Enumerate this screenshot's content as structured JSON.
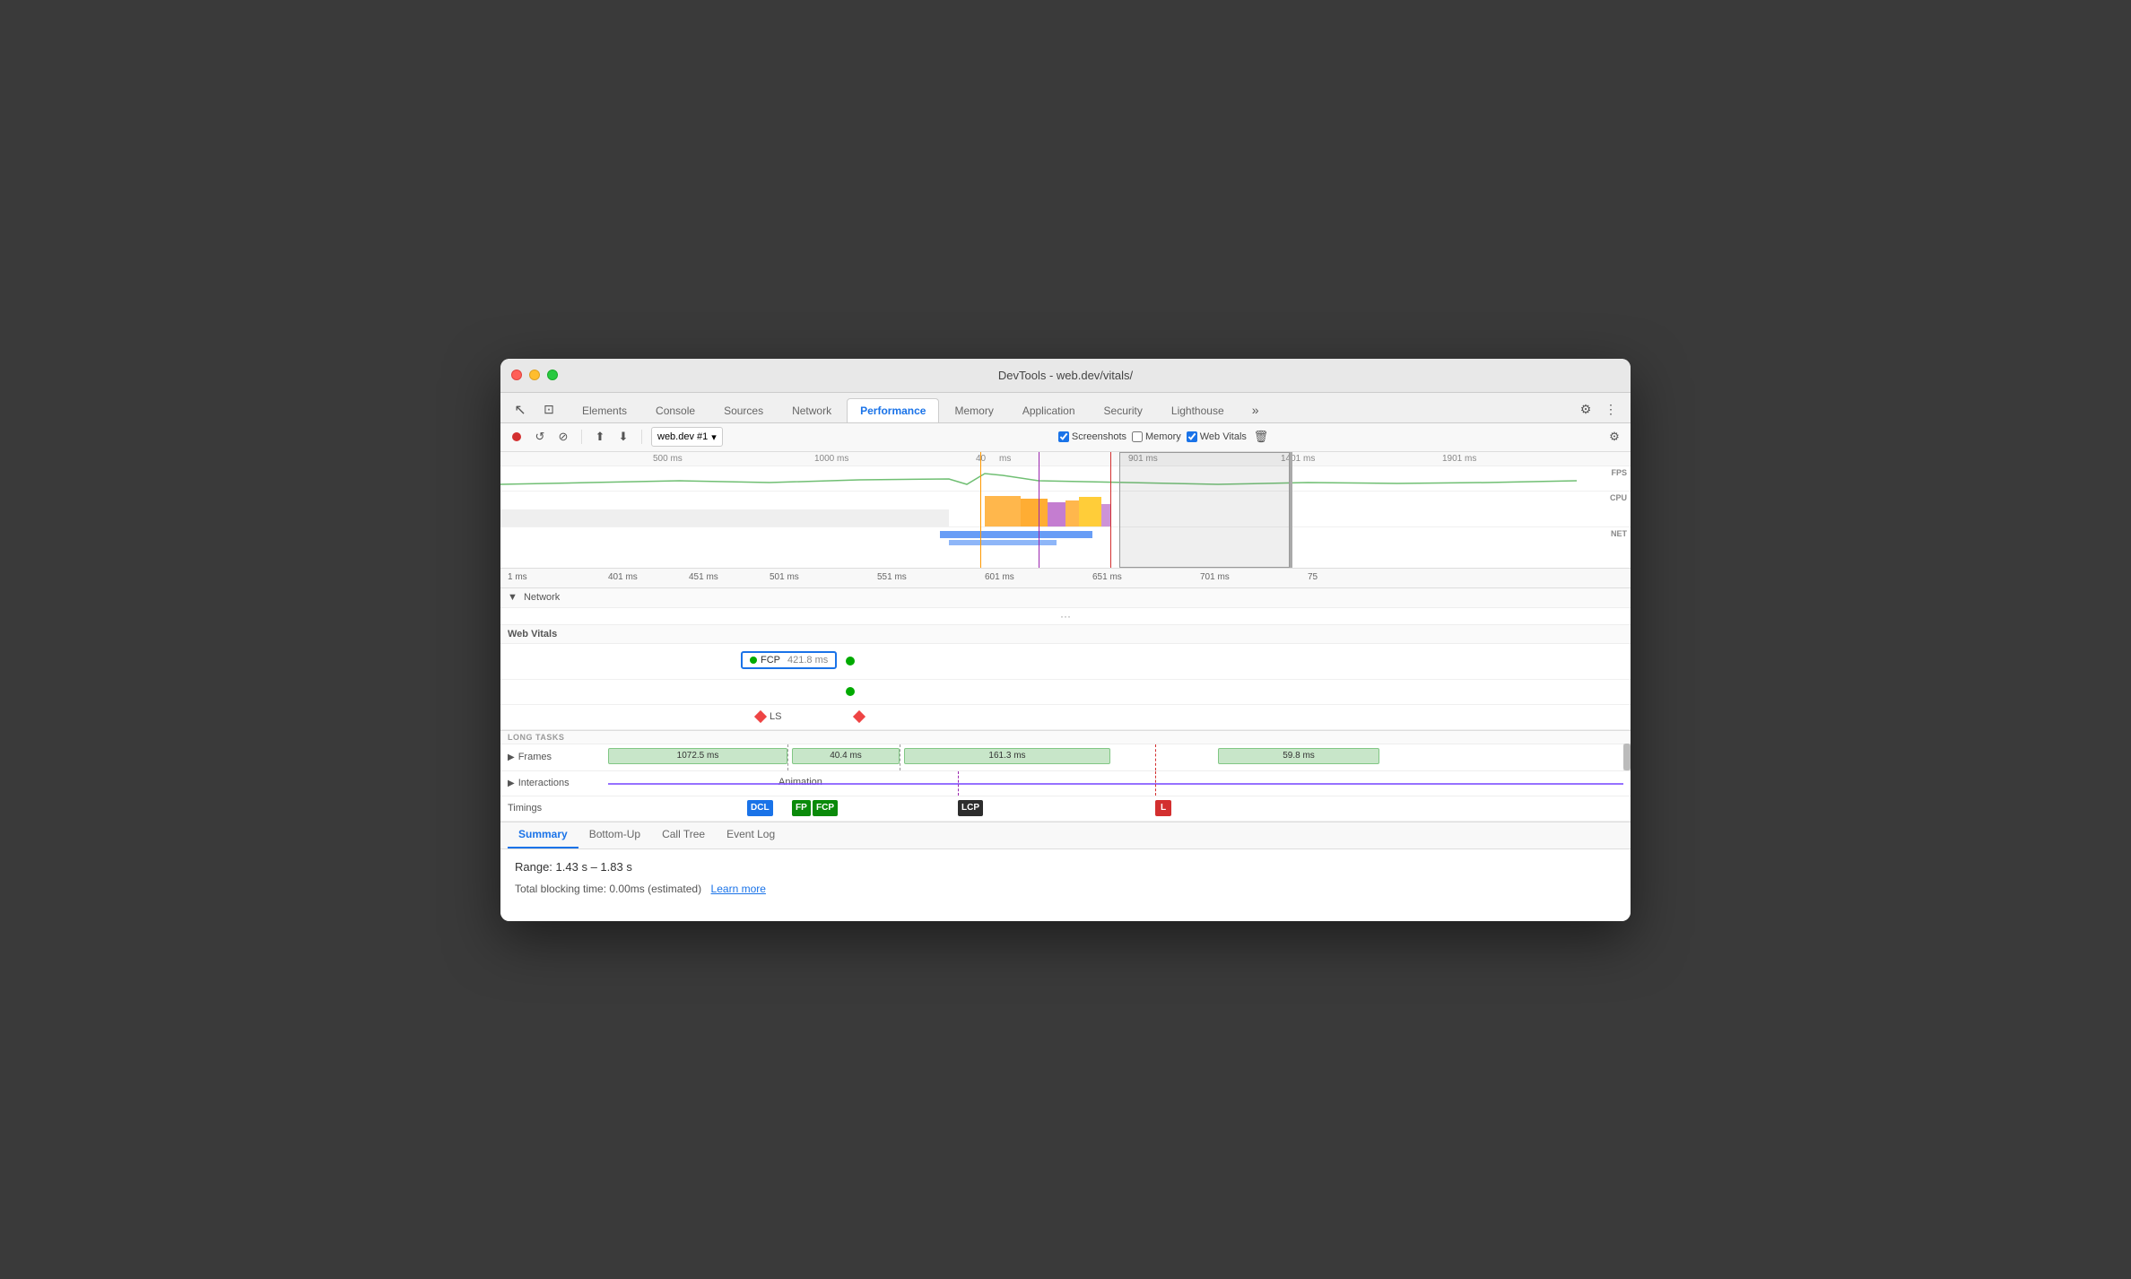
{
  "window": {
    "title": "DevTools - web.dev/vitals/"
  },
  "tabs": {
    "items": [
      {
        "label": "Elements",
        "active": false
      },
      {
        "label": "Console",
        "active": false
      },
      {
        "label": "Sources",
        "active": false
      },
      {
        "label": "Network",
        "active": false
      },
      {
        "label": "Performance",
        "active": true
      },
      {
        "label": "Memory",
        "active": false
      },
      {
        "label": "Application",
        "active": false
      },
      {
        "label": "Security",
        "active": false
      },
      {
        "label": "Lighthouse",
        "active": false
      }
    ]
  },
  "toolbar": {
    "source": "web.dev #1",
    "screenshots_label": "Screenshots",
    "memory_label": "Memory",
    "web_vitals_label": "Web Vitals"
  },
  "overview_ruler": {
    "ticks": [
      "500 ms",
      "1000 ms",
      "40",
      "ms",
      "901 ms",
      "1401 ms",
      "1901 ms"
    ]
  },
  "detail_ruler": {
    "ticks": [
      "1 ms",
      "401 ms",
      "451 ms",
      "501 ms",
      "551 ms",
      "601 ms",
      "651 ms",
      "701 ms",
      "75"
    ]
  },
  "network_track": {
    "label": "▼ Network"
  },
  "web_vitals": {
    "section_label": "Web Vitals",
    "fcp_label": "FCP",
    "fcp_value": "421.8 ms",
    "ls_label": "LS"
  },
  "long_tasks": {
    "header": "LONG TASKS"
  },
  "frames_track": {
    "label": "Frames",
    "bars": [
      {
        "width_pct": 22,
        "left_pct": 0,
        "label": "1072.5 ms"
      },
      {
        "width_pct": 14,
        "left_pct": 23,
        "label": "40.4 ms"
      },
      {
        "width_pct": 26,
        "left_pct": 38,
        "label": "161.3 ms"
      },
      {
        "width_pct": 20,
        "left_pct": 75,
        "label": "59.8 ms"
      }
    ]
  },
  "interactions_track": {
    "label": "Interactions",
    "animation_label": "Animation"
  },
  "timings_track": {
    "label": "Timings",
    "badges": [
      {
        "label": "DCL",
        "color": "#1a73e8",
        "left_pct": 18
      },
      {
        "label": "FP",
        "color": "#0a8a0a",
        "left_pct": 24
      },
      {
        "label": "FCP",
        "color": "#0a8a0a",
        "left_pct": 27
      },
      {
        "label": "LCP",
        "color": "#2d2d2d",
        "left_pct": 46
      },
      {
        "label": "L",
        "color": "#d32f2f",
        "left_pct": 64
      }
    ]
  },
  "bottom_tabs": {
    "items": [
      {
        "label": "Summary",
        "active": true
      },
      {
        "label": "Bottom-Up",
        "active": false
      },
      {
        "label": "Call Tree",
        "active": false
      },
      {
        "label": "Event Log",
        "active": false
      }
    ]
  },
  "summary": {
    "range_label": "Range:",
    "range_value": "1.43 s – 1.83 s",
    "blocking_text": "Total blocking time: 0.00ms (estimated)",
    "learn_more_label": "Learn more"
  },
  "fps_label": "FPS",
  "cpu_label": "CPU",
  "net_label": "NET"
}
